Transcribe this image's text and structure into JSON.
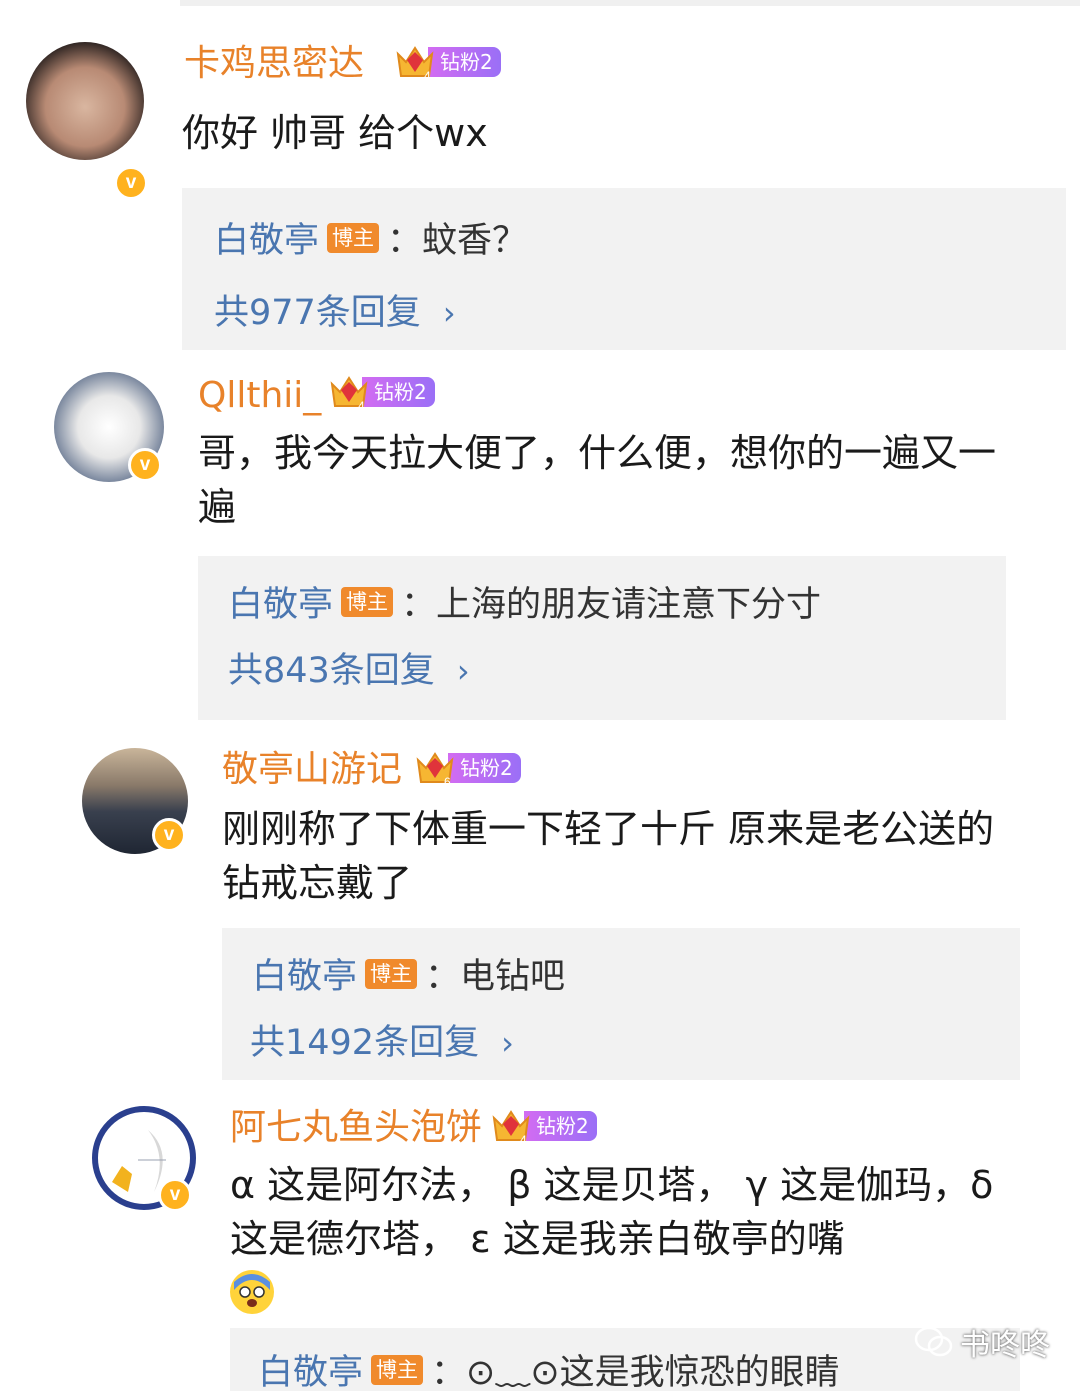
{
  "comments": [
    {
      "username": "卡鸡思密达",
      "badge": "钻粉2",
      "badge_level": "4",
      "text": "你好 帅哥 给个wx",
      "reply": {
        "author": "白敬亭",
        "role": "博主",
        "sep": "：",
        "text": "蚊香？",
        "count": "共977条回复"
      }
    },
    {
      "username": "Qllthii_",
      "badge": "钻粉2",
      "badge_level": "4",
      "text": "哥，我今天拉大便了，什么便，想你的一遍又一遍",
      "reply": {
        "author": "白敬亭",
        "role": "博主",
        "sep": "：",
        "text": "上海的朋友请注意下分寸",
        "count": "共843条回复"
      }
    },
    {
      "username": "敬亭山游记",
      "badge": "钻粉2",
      "badge_level": "6",
      "text": "刚刚称了下体重一下轻了十斤  原来是老公送的钻戒忘戴了",
      "reply": {
        "author": "白敬亭",
        "role": "博主",
        "sep": "：",
        "text": "电钻吧",
        "count": "共1492条回复"
      }
    },
    {
      "username": "阿七丸鱼头泡饼",
      "badge": "钻粉2",
      "badge_level": "4",
      "text": "α 这是阿尔法， β 这是贝塔， γ 这是伽玛，δ 这是德尔塔， ε 这是我亲白敬亭的嘴",
      "reply": {
        "author": "白敬亭",
        "role": "博主",
        "sep": "：",
        "text": "⊙﹏⊙这是我惊恐的眼睛",
        "count": ""
      }
    }
  ],
  "chevron": "›",
  "verified_mark": "v",
  "watermark": "书咚咚",
  "colors": {
    "username": "#e8822a",
    "reply_author": "#4a76b0",
    "bozhu_badge": "#f08a2c",
    "verified": "#ffb21e",
    "reply_bg": "#f2f2f2"
  }
}
